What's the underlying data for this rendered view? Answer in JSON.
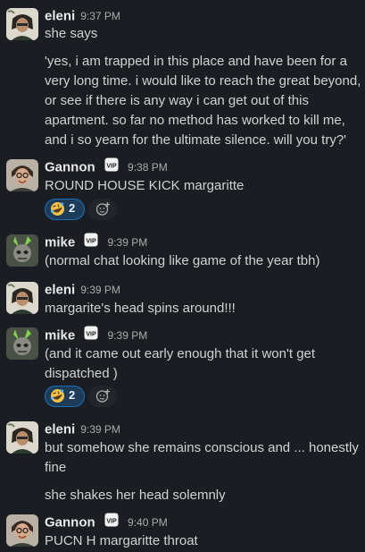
{
  "messages": [
    {
      "author": "eleni",
      "time": "9:37 PM",
      "vip": false,
      "lines": [
        "she says",
        "",
        "'yes, i am trapped in this place and have been for a",
        "very long time. i would like to reach the great beyond,",
        "or see if there is any way i can get out of this",
        "apartment. so far no method has worked to kill me,",
        "and i so yearn for the ultimate silence. will you try?'"
      ]
    },
    {
      "author": "Gannon",
      "time": "9:38 PM",
      "vip": true,
      "lines": [
        "ROUND HOUSE KICK margaritte"
      ],
      "reaction": {
        "emoji": "rolling-on-floor-laughing",
        "count": "2"
      }
    },
    {
      "author": "mike",
      "time": "9:39 PM",
      "vip": true,
      "lines": [
        "(normal chat looking like game of the year tbh)"
      ]
    },
    {
      "author": "eleni",
      "time": "9:39 PM",
      "vip": false,
      "lines": [
        "margarite's head spins around!!!"
      ]
    },
    {
      "author": "mike",
      "time": "9:39 PM",
      "vip": true,
      "lines": [
        "(and it came out early enough that it won't get",
        "dispatched )"
      ],
      "reaction": {
        "emoji": "rolling-on-floor-laughing",
        "count": "2"
      }
    },
    {
      "author": "eleni",
      "time": "9:39 PM",
      "vip": false,
      "lines": [
        "but somehow she remains conscious and ... honestly",
        "fine",
        "",
        "she shakes her head solemnly"
      ]
    },
    {
      "author": "Gannon",
      "time": "9:40 PM",
      "vip": true,
      "lines": [
        "PUCN H margaritte throat"
      ]
    }
  ],
  "badges": {
    "vip_icon": "vip-badge-icon"
  },
  "colors": {
    "background": "#1a1d21",
    "text": "#d1d2d3",
    "timestamp": "#ababad",
    "reaction_bg": "#1d3c5a",
    "reaction_border": "#1d6fb5"
  }
}
